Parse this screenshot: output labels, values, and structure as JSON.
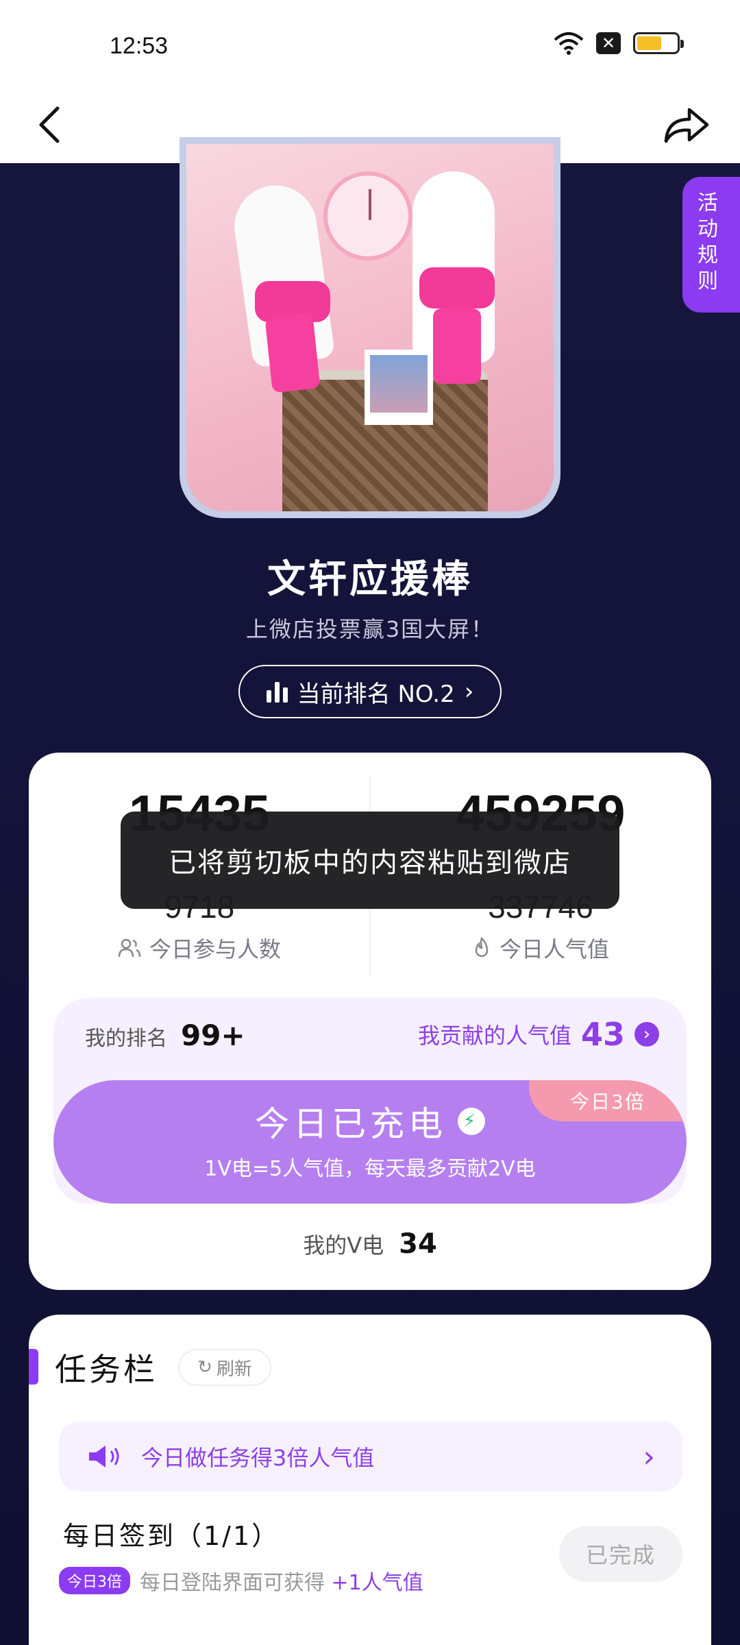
{
  "status": {
    "time": "12:53"
  },
  "rules_tab": {
    "label": "活动规则"
  },
  "hero": {
    "title": "文轩应援棒",
    "subtitle": "上微店投票赢3国大屏！",
    "rank_label": "当前排名 NO.2"
  },
  "stats": {
    "left_big": "15435",
    "right_big": "459259",
    "left_small": "9718",
    "right_small": "337746",
    "left_label": "今日参与人数",
    "right_label": "今日人气值"
  },
  "mine": {
    "rank_label": "我的排名",
    "rank_value": "99+",
    "contrib_label": "我贡献的人气值",
    "contrib_value": "43",
    "charge_title": "今日已充电",
    "charge_sub": "1V电=5人气值，每天最多贡献2V电",
    "badge": "今日3倍",
    "v_label": "我的V电",
    "v_value": "34"
  },
  "toast": {
    "text": "已将剪切板中的内容粘贴到微店"
  },
  "tasks": {
    "title": "任务栏",
    "refresh_label": "刷新",
    "notice": "今日做任务得3倍人气值",
    "item_name": "每日签到（1/1）",
    "item_tag": "今日3倍",
    "item_desc": "每日登陆界面可获得",
    "item_reward": "+1人气值",
    "item_status": "已完成"
  },
  "colors": {
    "accent": "#8b3bf2",
    "background": "#12123a",
    "charge": "#b57ff0"
  }
}
